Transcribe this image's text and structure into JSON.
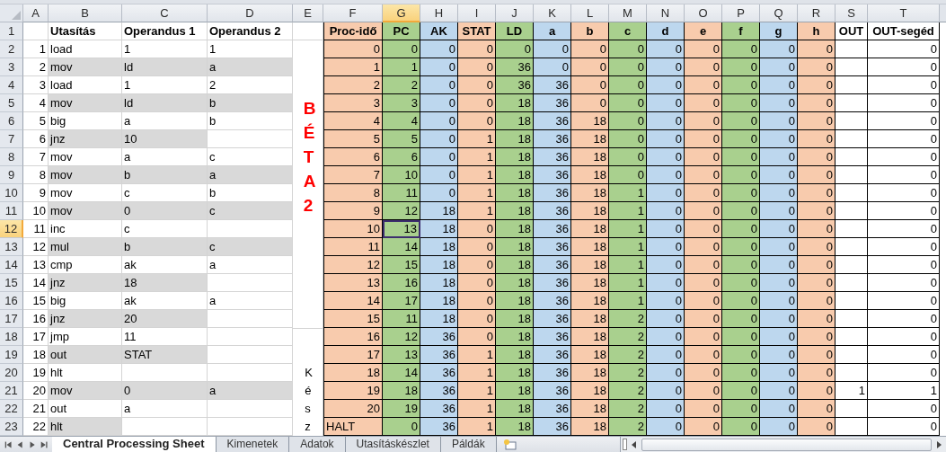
{
  "column_headers": [
    {
      "label": "A",
      "selected": false
    },
    {
      "label": "B",
      "selected": false
    },
    {
      "label": "C",
      "selected": false
    },
    {
      "label": "D",
      "selected": false
    },
    {
      "label": "E",
      "selected": false
    },
    {
      "label": "F",
      "selected": false
    },
    {
      "label": "G",
      "selected": true
    },
    {
      "label": "H",
      "selected": false
    },
    {
      "label": "I",
      "selected": false
    },
    {
      "label": "J",
      "selected": false
    },
    {
      "label": "K",
      "selected": false
    },
    {
      "label": "L",
      "selected": false
    },
    {
      "label": "M",
      "selected": false
    },
    {
      "label": "N",
      "selected": false
    },
    {
      "label": "O",
      "selected": false
    },
    {
      "label": "P",
      "selected": false
    },
    {
      "label": "Q",
      "selected": false
    },
    {
      "label": "R",
      "selected": false
    },
    {
      "label": "S",
      "selected": false
    },
    {
      "label": "T",
      "selected": false
    }
  ],
  "row_numbers": [
    {
      "label": "1",
      "selected": false
    },
    {
      "label": "2",
      "selected": false
    },
    {
      "label": "3",
      "selected": false
    },
    {
      "label": "4",
      "selected": false
    },
    {
      "label": "5",
      "selected": false
    },
    {
      "label": "6",
      "selected": false
    },
    {
      "label": "7",
      "selected": false
    },
    {
      "label": "8",
      "selected": false
    },
    {
      "label": "9",
      "selected": false
    },
    {
      "label": "10",
      "selected": false
    },
    {
      "label": "11",
      "selected": false
    },
    {
      "label": "12",
      "selected": true
    },
    {
      "label": "13",
      "selected": false
    },
    {
      "label": "14",
      "selected": false
    },
    {
      "label": "15",
      "selected": false
    },
    {
      "label": "16",
      "selected": false
    },
    {
      "label": "17",
      "selected": false
    },
    {
      "label": "18",
      "selected": false
    },
    {
      "label": "19",
      "selected": false
    },
    {
      "label": "20",
      "selected": false
    },
    {
      "label": "21",
      "selected": false
    },
    {
      "label": "22",
      "selected": false
    },
    {
      "label": "23",
      "selected": false
    }
  ],
  "program": {
    "headers": [
      "Utasítás",
      "Operandus 1",
      "Operandus 2"
    ],
    "rows": [
      {
        "number": "1",
        "instruction": "load",
        "operand_1": "1",
        "operand_2": "1",
        "shaded": false
      },
      {
        "number": "2",
        "instruction": "mov",
        "operand_1": "ld",
        "operand_2": "a",
        "shaded": true
      },
      {
        "number": "3",
        "instruction": "load",
        "operand_1": "1",
        "operand_2": "2",
        "shaded": false
      },
      {
        "number": "4",
        "instruction": "mov",
        "operand_1": "ld",
        "operand_2": "b",
        "shaded": true
      },
      {
        "number": "5",
        "instruction": "big",
        "operand_1": "a",
        "operand_2": "b",
        "shaded": false
      },
      {
        "number": "6",
        "instruction": "jnz",
        "operand_1": "10",
        "shaded": true
      },
      {
        "number": "7",
        "instruction": "mov",
        "operand_1": "a",
        "operand_2": "c",
        "shaded": false
      },
      {
        "number": "8",
        "instruction": "mov",
        "operand_1": "b",
        "operand_2": "a",
        "shaded": true
      },
      {
        "number": "9",
        "instruction": "mov",
        "operand_1": "c",
        "operand_2": "b",
        "shaded": false
      },
      {
        "number": "10",
        "instruction": "mov",
        "operand_1": "0",
        "operand_2": "c",
        "shaded": true
      },
      {
        "number": "11",
        "instruction": "inc",
        "operand_1": "c",
        "shaded": false
      },
      {
        "number": "12",
        "instruction": "mul",
        "operand_1": "b",
        "operand_2": "c",
        "shaded": true
      },
      {
        "number": "13",
        "instruction": "cmp",
        "operand_1": "ak",
        "operand_2": "a",
        "shaded": false
      },
      {
        "number": "14",
        "instruction": "jnz",
        "operand_1": "18",
        "shaded": true
      },
      {
        "number": "15",
        "instruction": "big",
        "operand_1": "ak",
        "operand_2": "a",
        "shaded": false
      },
      {
        "number": "16",
        "instruction": "jnz",
        "operand_1": "20",
        "shaded": true
      },
      {
        "number": "17",
        "instruction": "jmp",
        "operand_1": "11",
        "shaded": false
      },
      {
        "number": "18",
        "instruction": "out",
        "operand_1": "STAT",
        "shaded": true
      },
      {
        "number": "19",
        "instruction": "hlt",
        "shaded": false
      },
      {
        "number": "20",
        "instruction": "mov",
        "operand_1": "0",
        "operand_2": "a",
        "shaded": true
      },
      {
        "number": "21",
        "instruction": "out",
        "operand_1": "a",
        "shaded": false
      },
      {
        "number": "22",
        "instruction": "hlt",
        "shaded": true
      }
    ]
  },
  "side_labels": [
    {
      "text": "BÉTA 2",
      "kind": "highlight"
    },
    {
      "text": "Kész",
      "kind": "plain"
    }
  ],
  "trace": {
    "headers": [
      {
        "label": "Proc-idő",
        "color": "#f8cbad"
      },
      {
        "label": "PC",
        "color": "#a9d08e"
      },
      {
        "label": "AK",
        "color": "#bdd7ee"
      },
      {
        "label": "STAT",
        "color": "#f8cbad"
      },
      {
        "label": "LD",
        "color": "#a9d08e"
      },
      {
        "label": "a",
        "color": "#bdd7ee"
      },
      {
        "label": "b",
        "color": "#f8cbad"
      },
      {
        "label": "c",
        "color": "#a9d08e"
      },
      {
        "label": "d",
        "color": "#bdd7ee"
      },
      {
        "label": "e",
        "color": "#f8cbad"
      },
      {
        "label": "f",
        "color": "#a9d08e"
      },
      {
        "label": "g",
        "color": "#bdd7ee"
      },
      {
        "label": "h",
        "color": "#f8cbad"
      },
      {
        "label": "OUT",
        "color": "#ffffff"
      },
      {
        "label": "OUT-segéd",
        "color": "#ffffff"
      }
    ],
    "rows": [
      {
        "values": [
          "0",
          "0",
          "0",
          "0",
          "0",
          "0",
          "0",
          "0",
          "0",
          "0",
          "0",
          "0",
          "0"
        ],
        "out_helper": "0"
      },
      {
        "values": [
          "1",
          "1",
          "0",
          "0",
          "36",
          "0",
          "0",
          "0",
          "0",
          "0",
          "0",
          "0",
          "0"
        ],
        "out_helper": "0"
      },
      {
        "values": [
          "2",
          "2",
          "0",
          "0",
          "36",
          "36",
          "0",
          "0",
          "0",
          "0",
          "0",
          "0",
          "0"
        ],
        "out_helper": "0"
      },
      {
        "values": [
          "3",
          "3",
          "0",
          "0",
          "18",
          "36",
          "0",
          "0",
          "0",
          "0",
          "0",
          "0",
          "0"
        ],
        "out_helper": "0"
      },
      {
        "values": [
          "4",
          "4",
          "0",
          "0",
          "18",
          "36",
          "18",
          "0",
          "0",
          "0",
          "0",
          "0",
          "0"
        ],
        "out_helper": "0"
      },
      {
        "values": [
          "5",
          "5",
          "0",
          "1",
          "18",
          "36",
          "18",
          "0",
          "0",
          "0",
          "0",
          "0",
          "0"
        ],
        "out_helper": "0"
      },
      {
        "values": [
          "6",
          "6",
          "0",
          "1",
          "18",
          "36",
          "18",
          "0",
          "0",
          "0",
          "0",
          "0",
          "0"
        ],
        "out_helper": "0"
      },
      {
        "values": [
          "7",
          "10",
          "0",
          "1",
          "18",
          "36",
          "18",
          "0",
          "0",
          "0",
          "0",
          "0",
          "0"
        ],
        "out_helper": "0"
      },
      {
        "values": [
          "8",
          "11",
          "0",
          "1",
          "18",
          "36",
          "18",
          "1",
          "0",
          "0",
          "0",
          "0",
          "0"
        ],
        "out_helper": "0"
      },
      {
        "values": [
          "9",
          "12",
          "18",
          "1",
          "18",
          "36",
          "18",
          "1",
          "0",
          "0",
          "0",
          "0",
          "0"
        ],
        "out_helper": "0"
      },
      {
        "values": [
          "10",
          "13",
          "18",
          "0",
          "18",
          "36",
          "18",
          "1",
          "0",
          "0",
          "0",
          "0",
          "0"
        ],
        "out_helper": "0"
      },
      {
        "values": [
          "11",
          "14",
          "18",
          "0",
          "18",
          "36",
          "18",
          "1",
          "0",
          "0",
          "0",
          "0",
          "0"
        ],
        "out_helper": "0"
      },
      {
        "values": [
          "12",
          "15",
          "18",
          "0",
          "18",
          "36",
          "18",
          "1",
          "0",
          "0",
          "0",
          "0",
          "0"
        ],
        "out_helper": "0"
      },
      {
        "values": [
          "13",
          "16",
          "18",
          "0",
          "18",
          "36",
          "18",
          "1",
          "0",
          "0",
          "0",
          "0",
          "0"
        ],
        "out_helper": "0"
      },
      {
        "values": [
          "14",
          "17",
          "18",
          "0",
          "18",
          "36",
          "18",
          "1",
          "0",
          "0",
          "0",
          "0",
          "0"
        ],
        "out_helper": "0"
      },
      {
        "values": [
          "15",
          "11",
          "18",
          "0",
          "18",
          "36",
          "18",
          "2",
          "0",
          "0",
          "0",
          "0",
          "0"
        ],
        "out_helper": "0"
      },
      {
        "values": [
          "16",
          "12",
          "36",
          "0",
          "18",
          "36",
          "18",
          "2",
          "0",
          "0",
          "0",
          "0",
          "0"
        ],
        "out_helper": "0"
      },
      {
        "values": [
          "17",
          "13",
          "36",
          "1",
          "18",
          "36",
          "18",
          "2",
          "0",
          "0",
          "0",
          "0",
          "0"
        ],
        "out_helper": "0"
      },
      {
        "values": [
          "18",
          "14",
          "36",
          "1",
          "18",
          "36",
          "18",
          "2",
          "0",
          "0",
          "0",
          "0",
          "0"
        ],
        "out_helper": "0"
      },
      {
        "values": [
          "19",
          "18",
          "36",
          "1",
          "18",
          "36",
          "18",
          "2",
          "0",
          "0",
          "0",
          "0",
          "0"
        ],
        "out": "1",
        "out_helper": "1"
      },
      {
        "values": [
          "20",
          "19",
          "36",
          "1",
          "18",
          "36",
          "18",
          "2",
          "0",
          "0",
          "0",
          "0",
          "0"
        ],
        "out_helper": "0"
      },
      {
        "values": [
          "HALT",
          "0",
          "36",
          "1",
          "18",
          "36",
          "18",
          "2",
          "0",
          "0",
          "0",
          "0",
          "0"
        ],
        "out_helper": "0"
      }
    ]
  },
  "sheet_tabs": [
    {
      "label": "Central Processing Sheet",
      "selected": true
    },
    {
      "label": "Kimenetek",
      "selected": false
    },
    {
      "label": "Adatok",
      "selected": false
    },
    {
      "label": "Utasításkészlet",
      "selected": false
    },
    {
      "label": "Páldák",
      "selected": false
    }
  ]
}
